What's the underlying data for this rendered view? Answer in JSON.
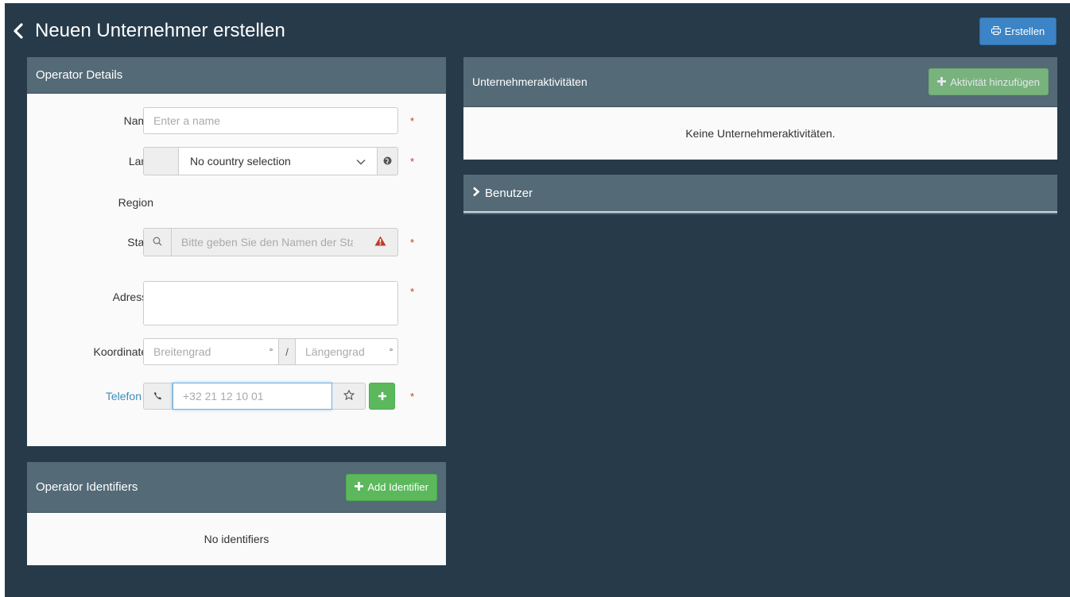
{
  "header": {
    "title": "Neuen Unternehmer erstellen",
    "create_label": "Erstellen"
  },
  "operator_details": {
    "title": "Operator Details",
    "name": {
      "label": "Name",
      "placeholder": "Enter a name",
      "required": "*"
    },
    "country": {
      "label": "Land",
      "selected": "No country selection",
      "required": "*"
    },
    "region": {
      "label": "Region"
    },
    "city": {
      "label": "Stadt",
      "placeholder": "Bitte geben Sie den Namen der Stadt",
      "required": "*"
    },
    "address": {
      "label": "Adresse",
      "required": "*"
    },
    "coordinates": {
      "label": "Koordinaten",
      "lat_placeholder": "Breitengrad",
      "lon_placeholder": "Längengrad",
      "degree": "°",
      "separator": "/"
    },
    "phone": {
      "label": "Telefon",
      "placeholder": "+32 21 12 10 01",
      "required": "*"
    }
  },
  "operator_identifiers": {
    "title": "Operator Identifiers",
    "add_label": "Add Identifier",
    "empty": "No identifiers"
  },
  "activities": {
    "title": "Unternehmeraktivitäten",
    "add_label": "Aktivität hinzufügen",
    "empty": "Keine Unternehmeraktivitäten."
  },
  "users": {
    "title": "Benutzer"
  },
  "colors": {
    "background": "#263a4a",
    "panel_header": "#546a77",
    "primary": "#3c84c6",
    "success": "#5cb85c",
    "required": "#c0392b",
    "link": "#3c8dbc"
  }
}
